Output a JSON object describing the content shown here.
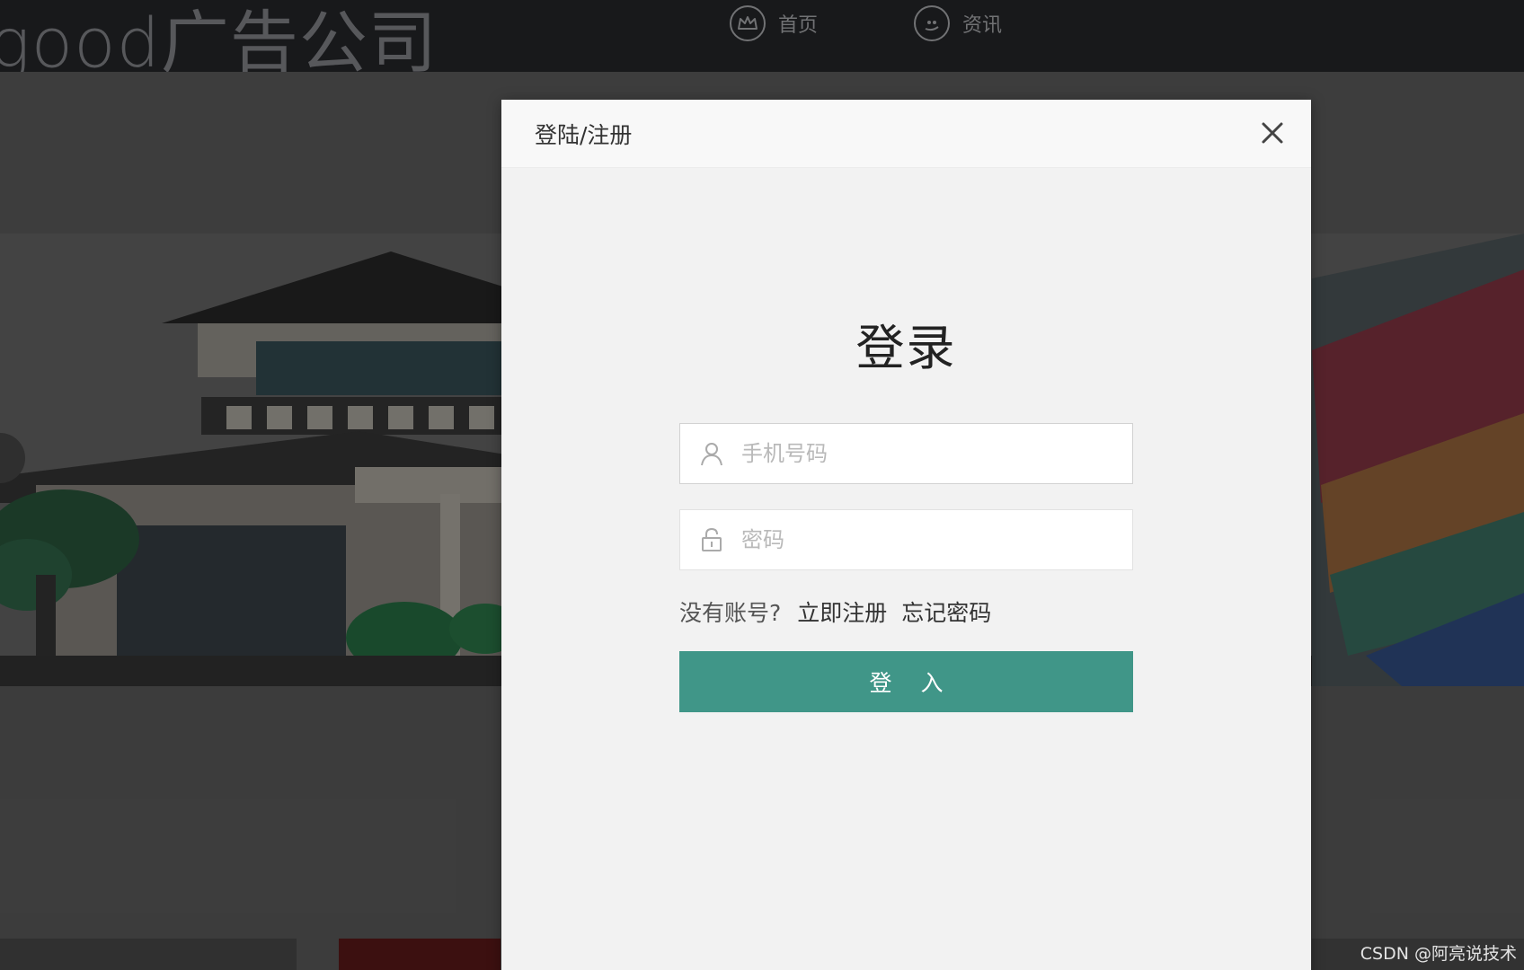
{
  "header": {
    "brand": "good广告公司",
    "nav": [
      {
        "label": "首页",
        "icon": "crown-icon"
      },
      {
        "label": "资讯",
        "icon": "chat-bubble-icon"
      }
    ]
  },
  "modal": {
    "title": "登陆/注册",
    "heading": "登录",
    "phone_placeholder": "手机号码",
    "password_placeholder": "密码",
    "no_account_text": "没有账号?",
    "register_link": "立即注册",
    "forgot_link": "忘记密码",
    "submit_label": "登 入"
  },
  "colors": {
    "accent": "#409688",
    "topbar": "#1e1f22",
    "modal_bg": "#f2f2f2"
  },
  "watermark": "CSDN @阿亮说技术"
}
